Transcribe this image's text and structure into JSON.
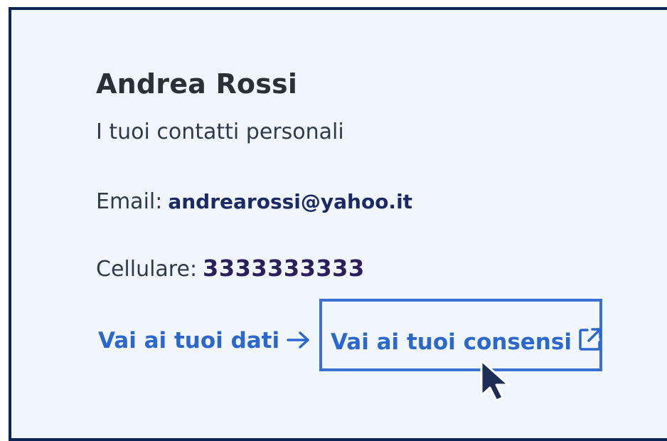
{
  "profile": {
    "name": "Andrea Rossi",
    "subtitle": "I tuoi contatti personali",
    "email_label": "Email:",
    "email_value": "andrearossi@yahoo.it",
    "phone_label": "Cellulare:",
    "phone_value": "3333333333"
  },
  "links": {
    "dati": "Vai ai tuoi dati",
    "consensi": "Vai ai tuoi consensi"
  },
  "icons": {
    "arrow": "arrow-right-icon",
    "external": "external-link-icon",
    "cursor": "mouse-pointer-icon"
  },
  "colors": {
    "card_background": "#f1f5fe",
    "card_border": "#0d2554",
    "link": "#2a68cf",
    "highlight_border": "#3a6fd6"
  }
}
